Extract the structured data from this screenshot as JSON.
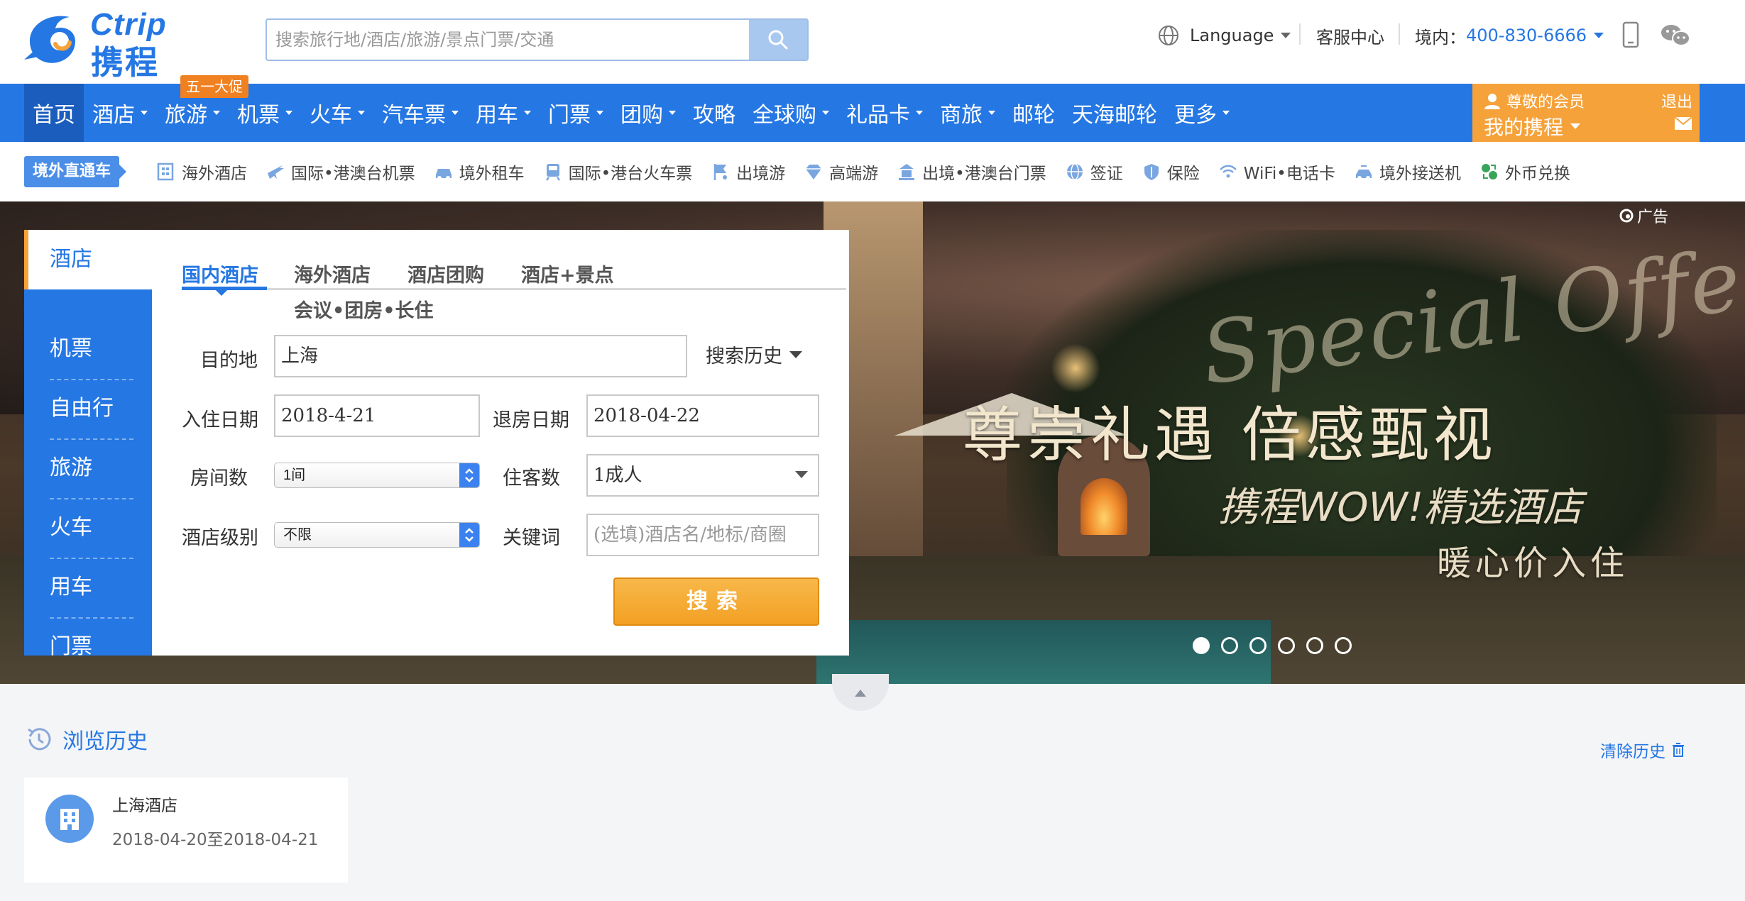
{
  "brand": {
    "en": "Ctrip",
    "cn": "携程",
    "color": "#2577e3"
  },
  "search": {
    "placeholder": "搜索旅行地/酒店/旅游/景点门票/交通"
  },
  "topbar": {
    "language": "Language",
    "service": "客服中心",
    "phone_label": "境内：",
    "phone": "400-830-6666"
  },
  "mainnav": {
    "items": [
      {
        "label": "首页",
        "caret": false
      },
      {
        "label": "酒店",
        "caret": true
      },
      {
        "label": "旅游",
        "caret": true
      },
      {
        "label": "机票",
        "caret": true
      },
      {
        "label": "火车",
        "caret": true
      },
      {
        "label": "汽车票",
        "caret": true
      },
      {
        "label": "用车",
        "caret": true
      },
      {
        "label": "门票",
        "caret": true
      },
      {
        "label": "团购",
        "caret": true
      },
      {
        "label": "攻略",
        "caret": false
      },
      {
        "label": "全球购",
        "caret": true
      },
      {
        "label": "礼品卡",
        "caret": true
      },
      {
        "label": "商旅",
        "caret": true
      },
      {
        "label": "邮轮",
        "caret": false
      },
      {
        "label": "天海邮轮",
        "caret": false
      },
      {
        "label": "更多",
        "caret": true
      }
    ],
    "promo_badge": "五一大促"
  },
  "member": {
    "name": "尊敬的会员",
    "my": "我的携程",
    "logout": "退出",
    "color": "#f6a23a"
  },
  "subnav": {
    "tag": "境外直通车",
    "items": [
      {
        "label": "海外酒店",
        "icon": "building-icon"
      },
      {
        "label": "国际•港澳台机票",
        "icon": "plane-icon"
      },
      {
        "label": "境外租车",
        "icon": "car-icon"
      },
      {
        "label": "国际•港台火车票",
        "icon": "train-icon"
      },
      {
        "label": "出境游",
        "icon": "flag-icon"
      },
      {
        "label": "高端游",
        "icon": "diamond-icon"
      },
      {
        "label": "出境•港澳台门票",
        "icon": "ticket-icon"
      },
      {
        "label": "签证",
        "icon": "globe-icon"
      },
      {
        "label": "保险",
        "icon": "shield-icon"
      },
      {
        "label": "WiFi•电话卡",
        "icon": "wifi-icon"
      },
      {
        "label": "境外接送机",
        "icon": "pickup-icon"
      },
      {
        "label": "外币兑换",
        "icon": "exchange-icon"
      }
    ]
  },
  "banner": {
    "ad_label": "广告",
    "special": "Special Offer",
    "headline": "尊崇礼遇  倍感甄视",
    "subline": "携程WOW!精选酒店",
    "tagline": "暖心价入住",
    "slides": 6,
    "active_slide": 1
  },
  "booking": {
    "side_items": [
      "酒店",
      "机票",
      "自由行",
      "旅游",
      "火车",
      "用车",
      "门票"
    ],
    "tabs": [
      "国内酒店",
      "海外酒店",
      "酒店团购",
      "酒店+景点"
    ],
    "tab2": "会议•团房•长住",
    "dest_label": "目的地",
    "dest_value": "上海",
    "history_label": "搜索历史",
    "checkin_label": "入住日期",
    "checkin_value": "2018-4-21",
    "checkout_label": "退房日期",
    "checkout_value": "2018-04-22",
    "rooms_label": "房间数",
    "rooms_value": "1间",
    "guests_label": "住客数",
    "guests_value": "1成人",
    "level_label": "酒店级别",
    "level_value": "不限",
    "keyword_label": "关键词",
    "keyword_placeholder": "(选填)酒店名/地标/商圈",
    "submit": "搜索"
  },
  "history": {
    "title": "浏览历史",
    "clear": "清除历史",
    "items": [
      {
        "name": "上海酒店",
        "dates": "2018-04-20至2018-04-21"
      }
    ]
  }
}
